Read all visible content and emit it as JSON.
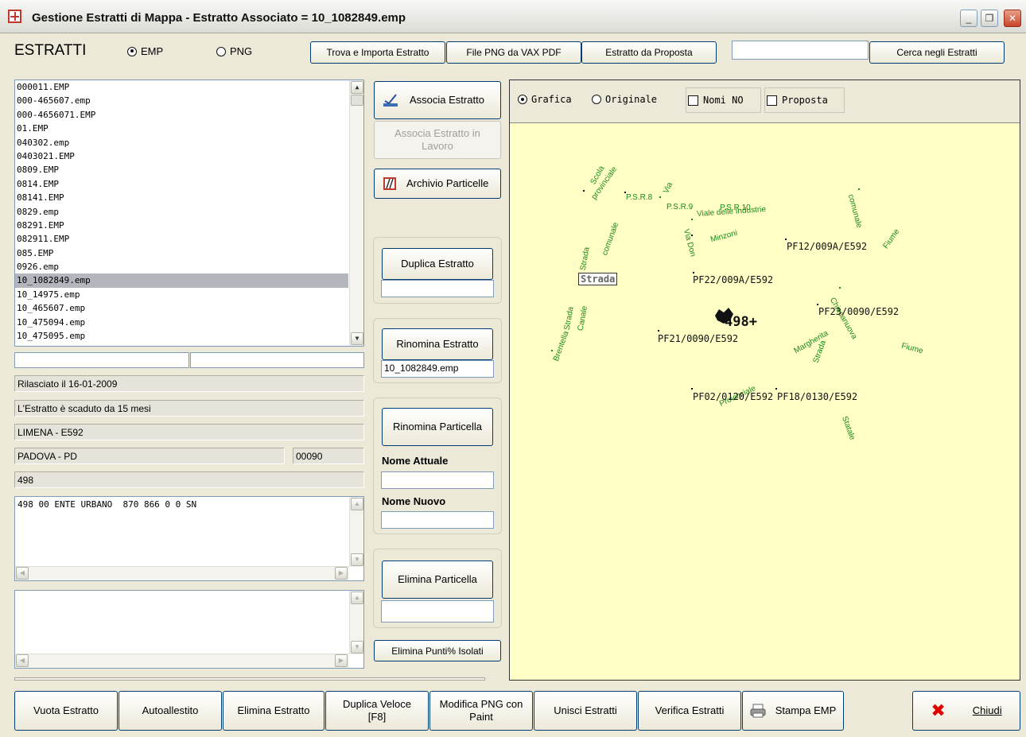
{
  "window": {
    "title": "Gestione Estratti di Mappa - Estratto Associato = 10_1082849.emp",
    "minimize": "_",
    "restore": "❐",
    "close": "✕"
  },
  "header": {
    "section_label": "ESTRATTI",
    "radio_emp": "EMP",
    "radio_png": "PNG",
    "selected_format": "EMP",
    "btn_trova": "Trova e Importa Estratto",
    "btn_png_vax": "File PNG da VAX PDF",
    "btn_da_proposta": "Estratto da Proposta",
    "search_value": "",
    "btn_cerca": "Cerca negli Estratti"
  },
  "file_list": {
    "items": [
      "000011.EMP",
      "000-465607.emp",
      "000-4656071.EMP",
      "01.EMP",
      "040302.emp",
      "0403021.EMP",
      "0809.EMP",
      "0814.EMP",
      "08141.EMP",
      "0829.emp",
      "08291.EMP",
      "082911.EMP",
      "085.EMP",
      "0926.emp",
      "10_1082849.emp",
      "10_14975.emp",
      "10_465607.emp",
      "10_475094.emp",
      "10_475095.emp"
    ],
    "selected": "10_1082849.emp"
  },
  "info": {
    "field_a": "",
    "field_b": "",
    "rilasciato": "Rilasciato il 16-01-2009",
    "scadenza": "L'Estratto è scaduto da 15 mesi",
    "comune": "LIMENA - E592",
    "provincia": "PADOVA - PD",
    "foglio": "00090",
    "particella": "498",
    "memo1_text": "498 00 ENTE URBANO  870 866 0 0 SN",
    "memo2_text": ""
  },
  "actions": {
    "associa": "Associa Estratto",
    "associa_lavoro": "Associa Estratto in Lavoro",
    "archivio": "Archivio Particelle",
    "duplica": "Duplica Estratto",
    "duplica_value": "",
    "rinomina_estratto": "Rinomina Estratto",
    "rinomina_value": "10_1082849.emp",
    "rinomina_particella": "Rinomina Particella",
    "nome_attuale_label": "Nome Attuale",
    "nome_attuale_value": "",
    "nome_nuovo_label": "Nome Nuovo",
    "nome_nuovo_value": "",
    "elimina_particella": "Elimina Particella",
    "elimina_value": "",
    "elimina_punti": "Elimina Punti% Isolati"
  },
  "map": {
    "opt_grafica": "Grafica",
    "opt_originale": "Originale",
    "chk_nomi": "Nomi NO",
    "chk_proposta": "Proposta",
    "view_mode": "Grafica",
    "nomi_no": false,
    "proposta": false,
    "street_labels": [
      "Scola",
      "provinciale",
      "P.S.R.8",
      "Via",
      "P.S.R.9",
      "Viale delle Industrie",
      "P.S.R.10",
      "comunale",
      "Strada",
      "Via Don",
      "Minzoni",
      "comunale",
      "Fiume",
      "Strada",
      "Brentella",
      "Canale",
      "Chiesanuova",
      "Margherita",
      "Strada",
      "Fiume",
      "Statale",
      "Provinciale"
    ],
    "boxed_label": "Strada",
    "parcel_labels": [
      "PF12/009A/E592",
      "PF22/009A/E592",
      "PF23/0090/E592",
      "PF21/0090/E592",
      "PF02/0120/E592",
      "PF18/0130/E592"
    ],
    "parcel_highlight": "498+",
    "text_color": "#1a8a1a",
    "canvas_color": "#ffffc6"
  },
  "bottom": {
    "vuota": "Vuota Estratto",
    "autoallestito": "Autoallestito",
    "elimina": "Elimina Estratto",
    "duplica_veloce": "Duplica Veloce [F8]",
    "modifica_png": "Modifica PNG con Paint",
    "unisci": "Unisci Estratti",
    "verifica": "Verifica Estratti",
    "stampa": "Stampa EMP",
    "chiudi": "Chiudi"
  }
}
